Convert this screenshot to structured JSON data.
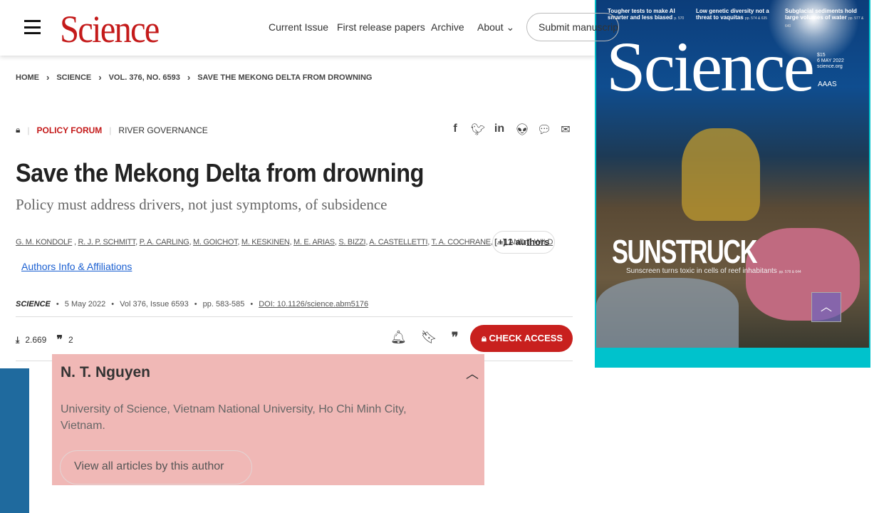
{
  "header": {
    "logo": "Science",
    "nav": [
      "Current Issue",
      "First release papers",
      "Archive",
      "About"
    ],
    "submit": "Submit manuscript"
  },
  "breadcrumb": [
    "HOME",
    "SCIENCE",
    "VOL. 376, NO. 6593",
    "SAVE THE MEKONG DELTA FROM DROWNING"
  ],
  "article": {
    "section": "POLICY FORUM",
    "topic": "RIVER GOVERNANCE",
    "title": "Save the Mekong Delta from drowning",
    "subtitle": "Policy must address drivers, not just symptoms, of subsidence",
    "authors": [
      "G. M. KONDOLF",
      "R. J. P. SCHMITT",
      "P. A. CARLING",
      "M. GOICHOT",
      "M. KESKINEN",
      "M. E. ARIAS",
      "S. BIZZI",
      "A. CASTELLETTI",
      "T. A. COCHRANE"
    ],
    "ellipsis": "[...]",
    "and": "AND",
    "last_author": "T. WILD",
    "more_authors": "+11 authors",
    "affiliations_link": "Authors Info & Affiliations",
    "journal": "SCIENCE",
    "date": "5 May 2022",
    "volume": "Vol 376, Issue 6593",
    "pages": "pp. 583-585",
    "doi": "DOI: 10.1126/science.abm5176",
    "downloads": "2.669",
    "citations": "2",
    "check_access": "CHECK ACCESS"
  },
  "cover": {
    "headlines": [
      {
        "text": "Tougher tests to make AI smarter and less biased",
        "ref": "p. 570"
      },
      {
        "text": "Low genetic diversity not a threat to vaquitas",
        "ref": "pp. 574 & 635"
      },
      {
        "text": "Subglacial sediments hold large volumes of water",
        "ref": "pp. 577 & 640"
      }
    ],
    "masthead": "Science",
    "price": "$15",
    "date": "6 MAY 2022",
    "site": "science.org",
    "publisher": "AAAS",
    "feature": "SUNSTRUCK",
    "feature_desc": "Sunscreen turns toxic in cells of reef inhabitants",
    "feature_ref": "pp. 578 & 644",
    "accent": "#00c2cc"
  },
  "popup": {
    "name": "N. T. Nguyen",
    "affiliation": "University of Science, Vietnam National University, Ho Chi Minh City, Vietnam.",
    "button": "View all articles by this author"
  },
  "colors": {
    "brand": "#c41a1a",
    "check_access": "#c8201e",
    "popup_bg": "#f0b8b6",
    "side_bar": "#1f6a9e"
  }
}
